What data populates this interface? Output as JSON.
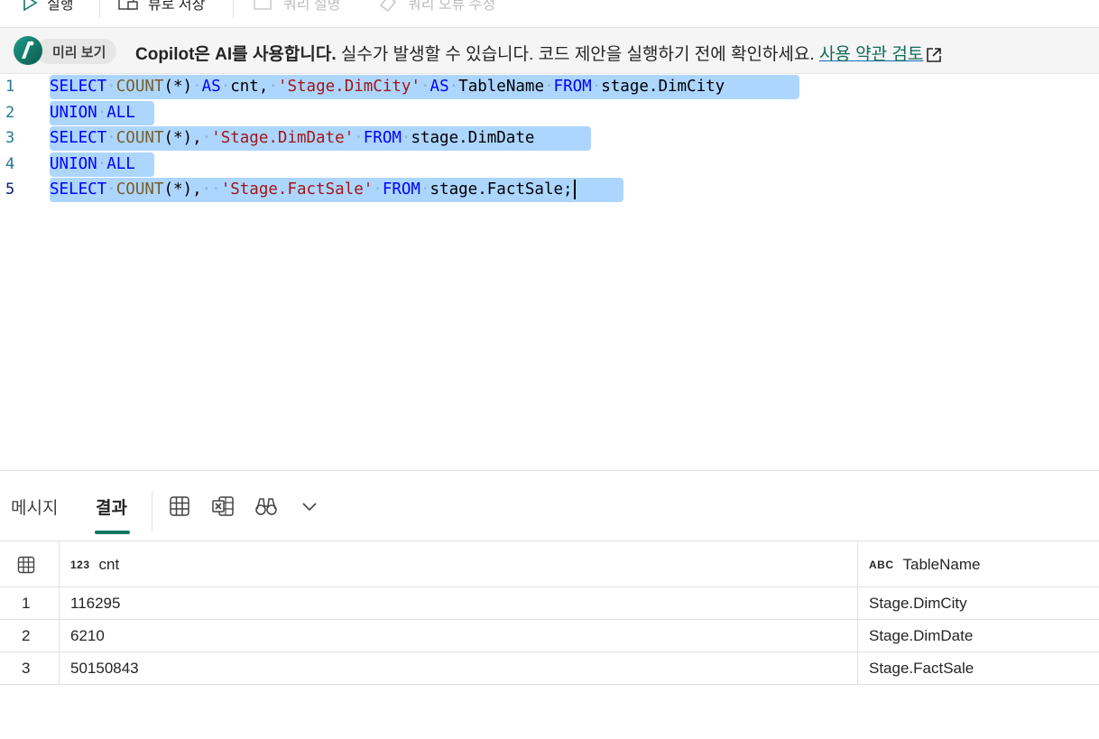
{
  "toolbar": {
    "run_label": "실행",
    "save_view_label": "뷰로 저장",
    "explain_query_label": "쿼리 설명",
    "fix_query_label": "쿼리 오류 수정"
  },
  "banner": {
    "preview_label": "미리 보기",
    "bold_text": "Copilot은 AI를 사용합니다.",
    "text": " 실수가 발생할 수 있습니다. 코드 제안을 실행하기 전에 확인하세요.",
    "link_text": "사용 약관 검토"
  },
  "editor": {
    "lines": [
      {
        "number": "1"
      },
      {
        "number": "2"
      },
      {
        "number": "3"
      },
      {
        "number": "4"
      },
      {
        "number": "5"
      }
    ],
    "tokens": {
      "select": "SELECT",
      "count": "COUNT",
      "count_args": "(*)",
      "comma": ",",
      "as": "AS",
      "cnt": "cnt",
      "str_city": "'Stage.DimCity'",
      "tablename": "TableName",
      "from": "FROM",
      "tbl_city": "stage.DimCity",
      "union": "UNION",
      "all": "ALL",
      "str_date": "'Stage.DimDate'",
      "tbl_date": "stage.DimDate",
      "str_sale": "'Stage.FactSale'",
      "tbl_sale": "stage.FactSale;"
    }
  },
  "results": {
    "tabs": [
      {
        "label": "메시지"
      },
      {
        "label": "결과"
      }
    ],
    "columns": [
      {
        "type_tag": "123",
        "name": "cnt"
      },
      {
        "type_tag": "ABC",
        "name": "TableName"
      }
    ],
    "rows": [
      {
        "index": "1",
        "cnt": "116295",
        "table": "Stage.DimCity"
      },
      {
        "index": "2",
        "cnt": "6210",
        "table": "Stage.DimDate"
      },
      {
        "index": "3",
        "cnt": "50150843",
        "table": "Stage.FactSale"
      }
    ]
  },
  "colors": {
    "accent": "#117865",
    "selection": "#add6ff",
    "keyword": "#0000ff",
    "string": "#a31515",
    "function": "#795e26"
  }
}
